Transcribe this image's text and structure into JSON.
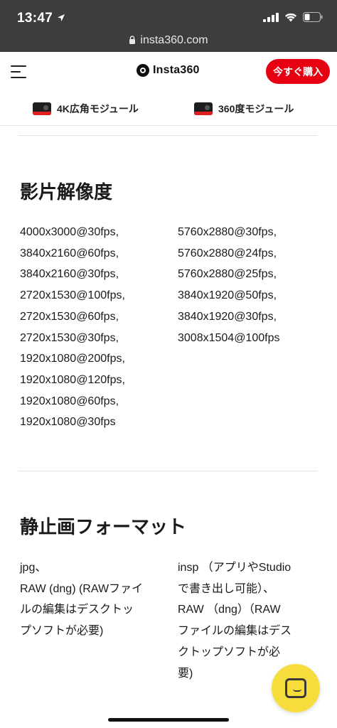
{
  "status_bar": {
    "time": "13:47"
  },
  "browser": {
    "url": "insta360.com"
  },
  "header": {
    "logo_text": "Insta360",
    "buy_button": "今すぐ購入"
  },
  "modules": [
    {
      "label": "4K広角モジュール"
    },
    {
      "label": "360度モジュール"
    }
  ],
  "video_resolution": {
    "title": "影片解像度",
    "left": [
      "4000x3000@30fps,",
      "3840x2160@60fps,",
      "3840x2160@30fps,",
      "2720x1530@100fps,",
      "2720x1530@60fps,",
      "2720x1530@30fps,",
      "1920x1080@200fps,",
      "1920x1080@120fps,",
      "1920x1080@60fps,",
      "1920x1080@30fps"
    ],
    "right": [
      "5760x2880@30fps,",
      "5760x2880@24fps,",
      "5760x2880@25fps,",
      "3840x1920@50fps,",
      "3840x1920@30fps,",
      "3008x1504@100fps"
    ]
  },
  "photo_format": {
    "title": "静止画フォーマット",
    "left_lines": [
      "jpg、",
      "RAW (dng) (RAWファイ",
      "ルの編集はデスクトッ",
      "プソフトが必要)"
    ],
    "right_lines": [
      "insp （アプリやStudio",
      "で書き出し可能）、",
      "RAW （dng）（RAW",
      "ファイルの編集はデス",
      "クトップソフトが必",
      "要)"
    ]
  },
  "icons": {
    "menu": "hamburger-menu-icon",
    "chat": "chat-bubble-icon",
    "lock": "lock-icon",
    "location": "location-arrow-icon"
  },
  "colors": {
    "accent": "#e60012",
    "chat": "#f7dd3b",
    "topbar": "#3d3d3d"
  }
}
